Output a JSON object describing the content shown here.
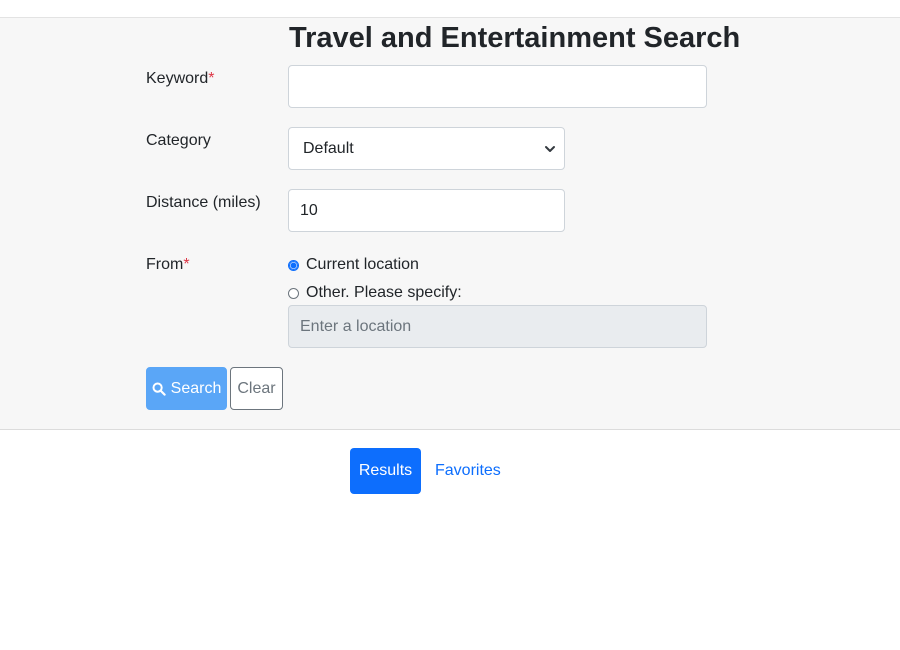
{
  "form": {
    "title": "Travel and Entertainment Search",
    "keyword_label": "Keyword",
    "keyword_value": "",
    "required_mark": "*",
    "category_label": "Category",
    "category_value": "Default",
    "distance_label": "Distance (miles)",
    "distance_value": "10",
    "from_label": "From",
    "from_options": {
      "current": "Current location",
      "other": "Other. Please specify:"
    },
    "location_placeholder": "Enter a location",
    "selected_from": "current"
  },
  "buttons": {
    "search_label": "Search",
    "clear_label": "Clear"
  },
  "tabs": {
    "results_label": "Results",
    "favorites_label": "Favorites",
    "active": "results"
  },
  "icons": {
    "search": "search-icon",
    "select_chevron": "chevron-down-icon"
  },
  "colors": {
    "accent": "#0d6efd",
    "search_button": "#5aa6f7",
    "required": "#dc3545",
    "panel_background": "#f7f7f7"
  }
}
